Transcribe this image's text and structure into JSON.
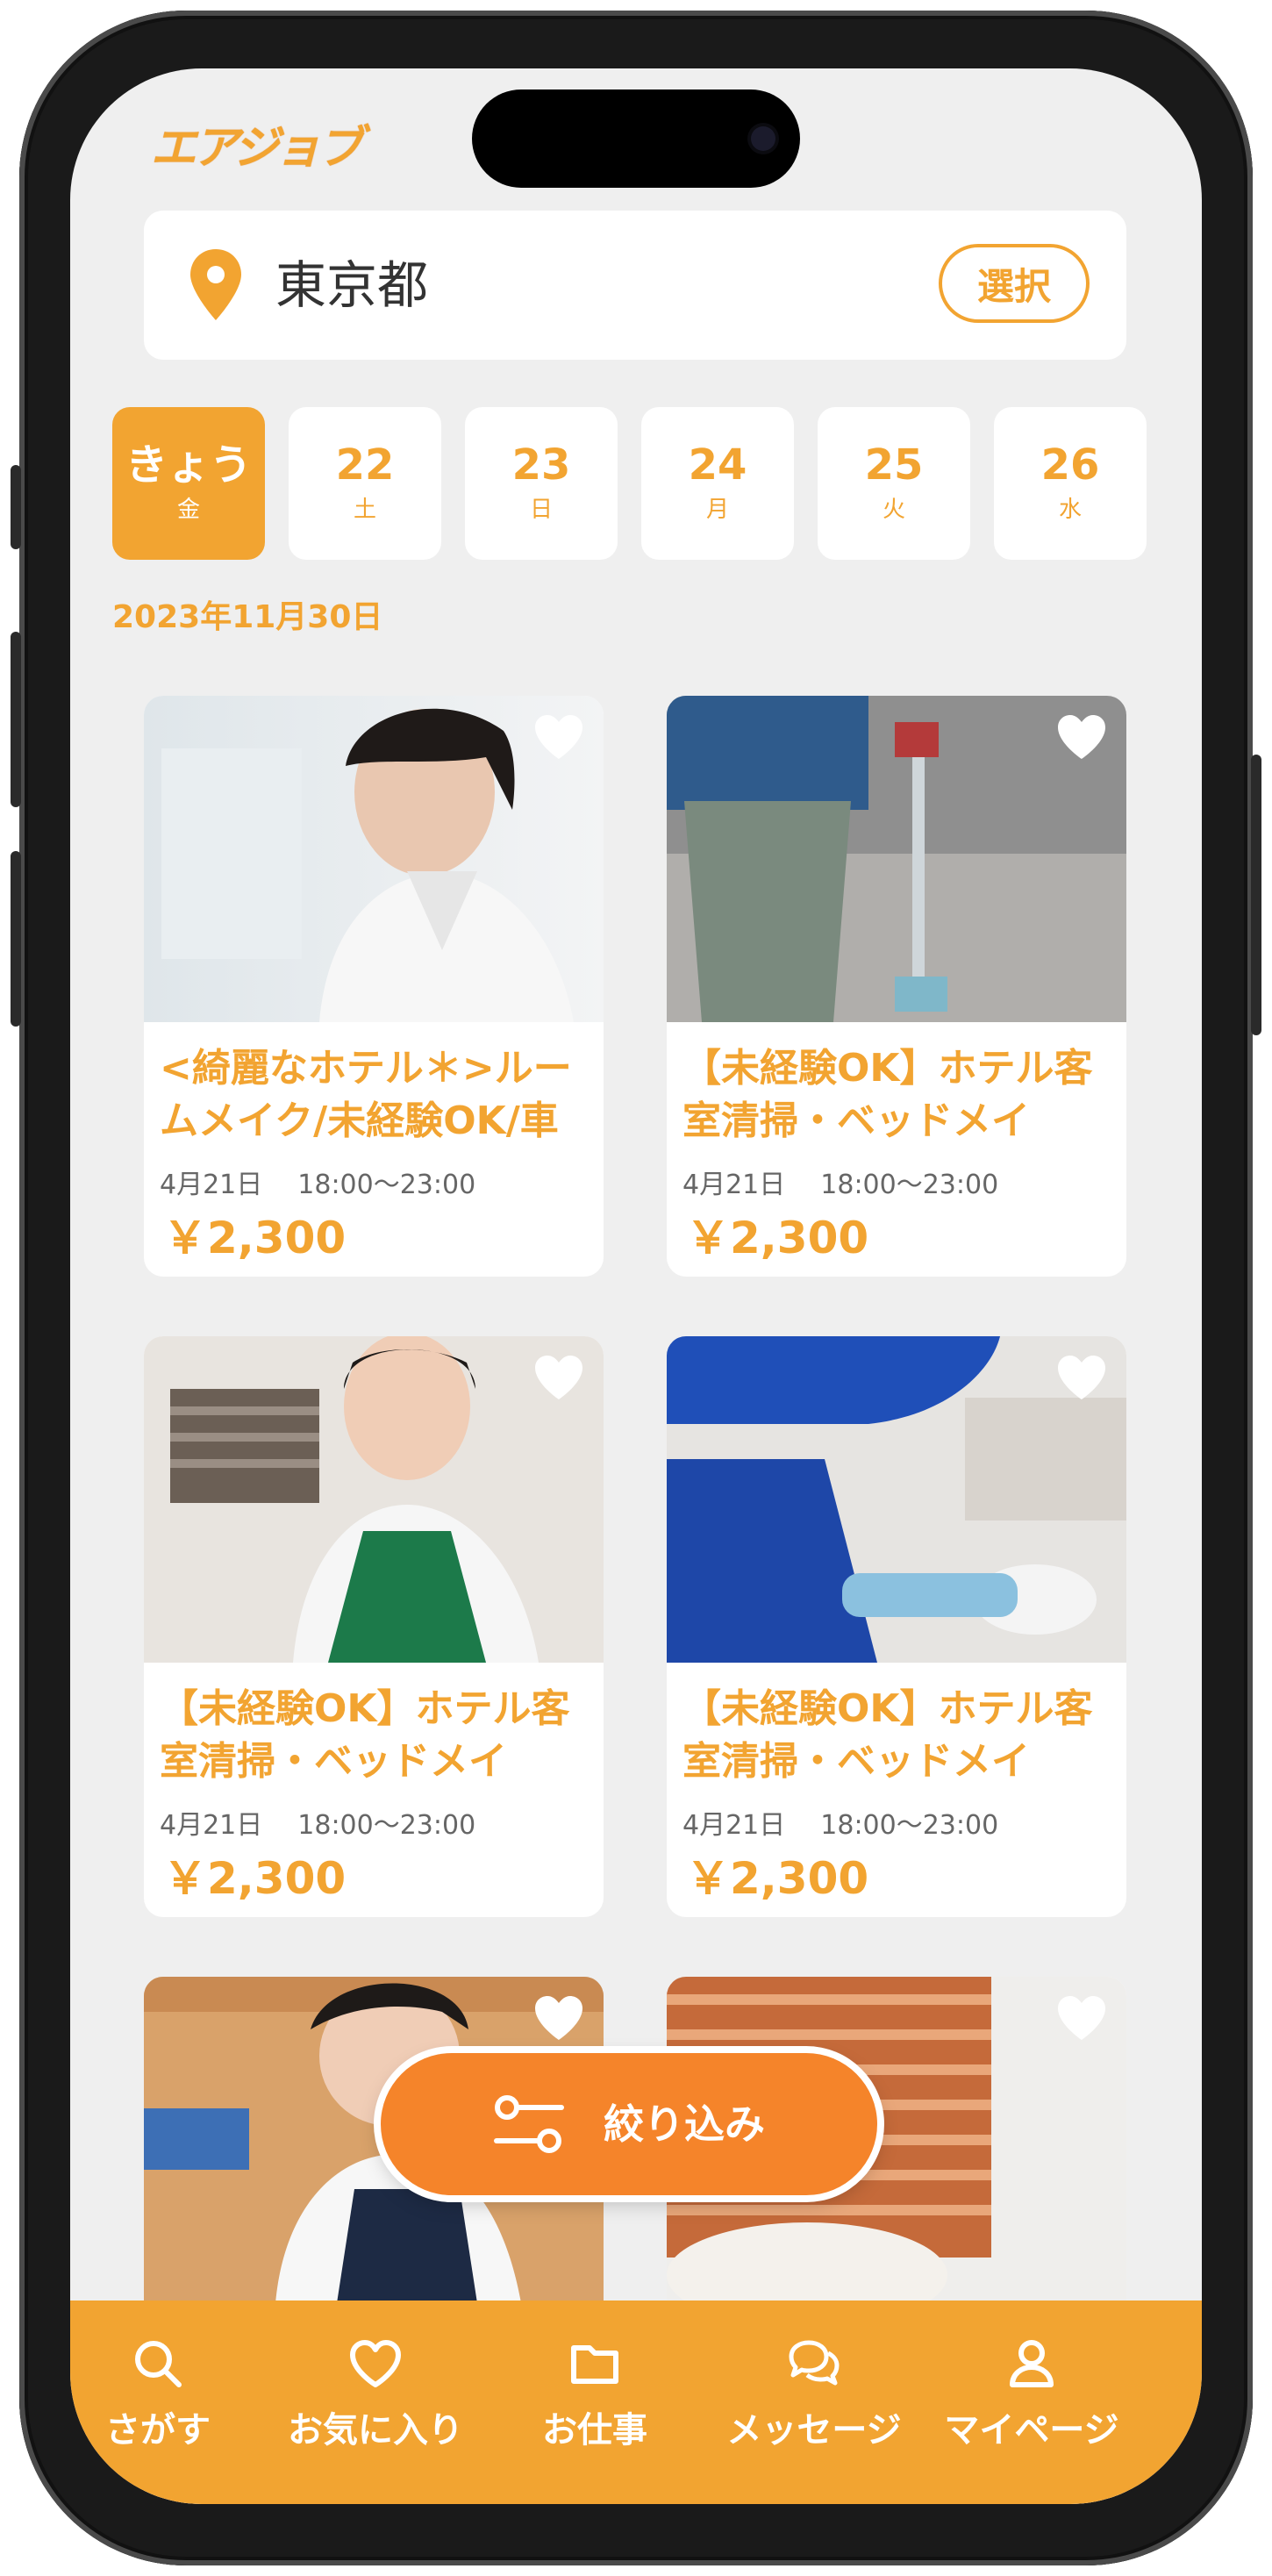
{
  "app": {
    "logo_text": "エアジョブ"
  },
  "location": {
    "value": "東京都",
    "select_label": "選択"
  },
  "dates": [
    {
      "num": "きょう",
      "dow": "金",
      "active": true
    },
    {
      "num": "22",
      "dow": "土"
    },
    {
      "num": "23",
      "dow": "日"
    },
    {
      "num": "24",
      "dow": "月"
    },
    {
      "num": "25",
      "dow": "火"
    },
    {
      "num": "26",
      "dow": "水"
    }
  ],
  "date_label": "2023年11月30日",
  "jobs": [
    {
      "title": "<綺麗なホテル＊>ルームメイク/未経験OK/車",
      "date": "4月21日",
      "time": "18:00〜23:00",
      "price": "￥2,300"
    },
    {
      "title": "【未経験OK】ホテル客室清掃・ベッドメイ",
      "date": "4月21日",
      "time": "18:00〜23:00",
      "price": "￥2,300"
    },
    {
      "title": "【未経験OK】ホテル客室清掃・ベッドメイ",
      "date": "4月21日",
      "time": "18:00〜23:00",
      "price": "￥2,300"
    },
    {
      "title": "【未経験OK】ホテル客室清掃・ベッドメイ",
      "date": "4月21日",
      "time": "18:00〜23:00",
      "price": "￥2,300"
    },
    {
      "title": "",
      "date": "",
      "time": "",
      "price": ""
    },
    {
      "title": "",
      "date": "",
      "time": "",
      "price": ""
    }
  ],
  "filter": {
    "label": "絞り込み"
  },
  "tabs": [
    {
      "label": "さがす",
      "icon": "search-icon"
    },
    {
      "label": "お気に入り",
      "icon": "heart-icon"
    },
    {
      "label": "お仕事",
      "icon": "folder-icon"
    },
    {
      "label": "メッセージ",
      "icon": "chat-icon"
    },
    {
      "label": "マイページ",
      "icon": "user-icon"
    }
  ],
  "colors": {
    "accent": "#f2a431",
    "filter": "#f5842a",
    "background": "#efefef"
  }
}
